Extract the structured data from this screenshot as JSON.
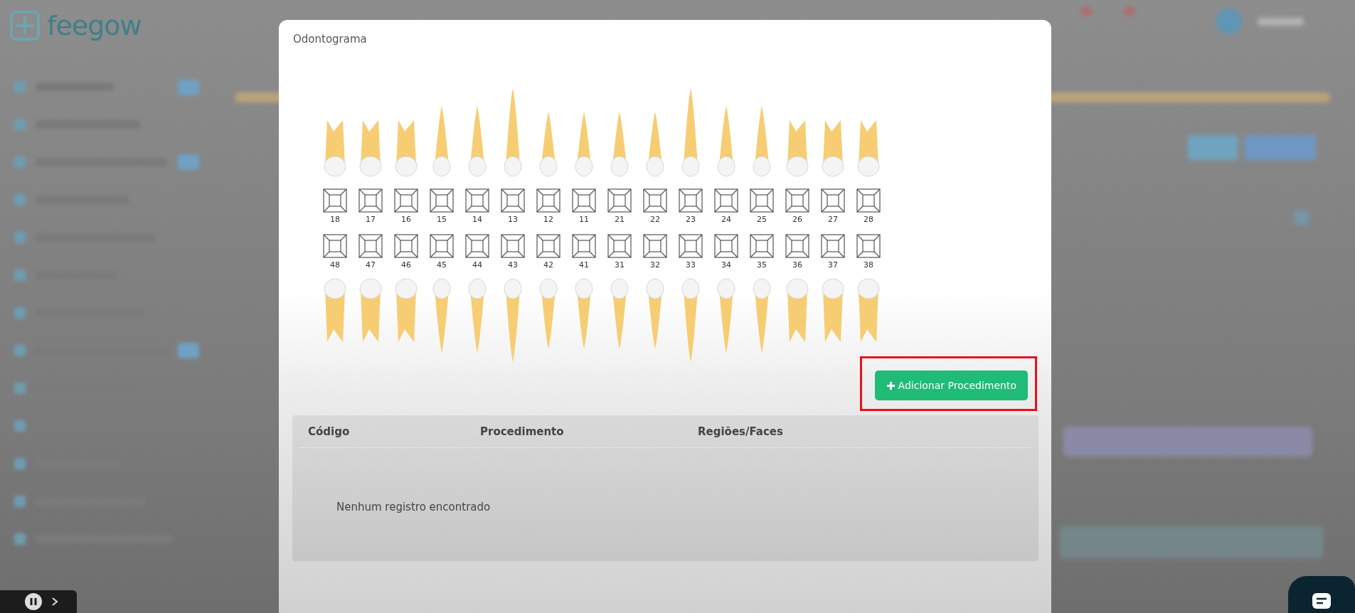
{
  "app": {
    "logo": "feegow"
  },
  "modal": {
    "title": "Odontograma",
    "upper_teeth": [
      "18",
      "17",
      "16",
      "15",
      "14",
      "13",
      "12",
      "11",
      "21",
      "22",
      "23",
      "24",
      "25",
      "26",
      "27",
      "28"
    ],
    "lower_teeth": [
      "48",
      "47",
      "46",
      "45",
      "44",
      "43",
      "42",
      "41",
      "31",
      "32",
      "33",
      "34",
      "35",
      "36",
      "37",
      "38"
    ],
    "add_button": "Adicionar Procedimento",
    "table": {
      "columns": [
        "Código",
        "Procedimento",
        "Regiões/Faces"
      ],
      "empty_message": "Nenhum registro encontrado"
    }
  }
}
